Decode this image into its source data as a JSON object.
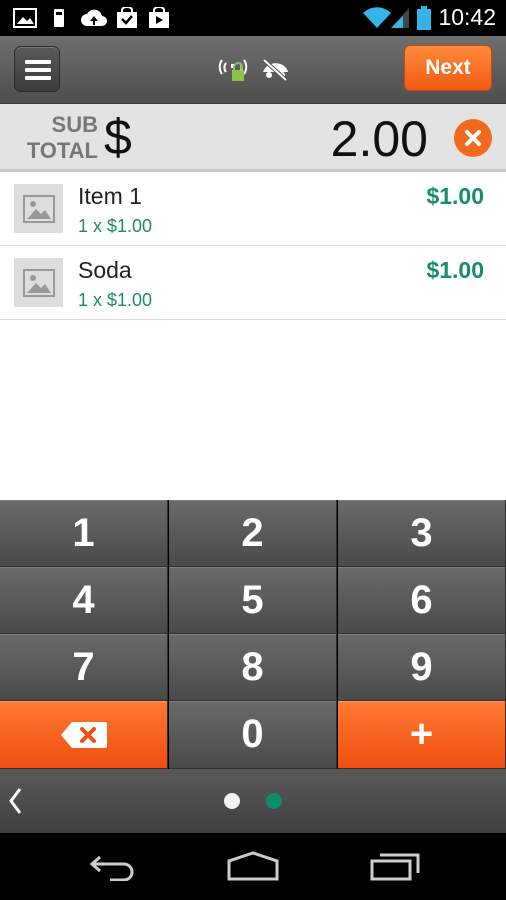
{
  "status_bar": {
    "time": "10:42",
    "icons": [
      "image-icon",
      "sim-icon",
      "cloud-upload-icon",
      "bag-check-icon",
      "play-store-icon",
      "wifi-icon",
      "signal-icon",
      "battery-icon"
    ]
  },
  "action_bar": {
    "next_label": "Next",
    "icons": [
      "menu-icon",
      "secure-wireless-icon",
      "hidden-icon"
    ]
  },
  "subtotal": {
    "label_line1": "SUB",
    "label_line2": "TOTAL",
    "currency_symbol": "$",
    "amount": "2.00"
  },
  "items": [
    {
      "name": "Item 1",
      "qty_line": "1 x $1.00",
      "price": "$1.00"
    },
    {
      "name": "Soda",
      "qty_line": "1 x $1.00",
      "price": "$1.00"
    }
  ],
  "keypad": {
    "keys": [
      "1",
      "2",
      "3",
      "4",
      "5",
      "6",
      "7",
      "8",
      "9",
      "0"
    ],
    "plus": "+"
  },
  "colors": {
    "accent_orange": "#f25a12",
    "money_green": "#1b8a6d",
    "page_dot_active": "#0f8a6a",
    "page_dot_inactive": "#f2f2f2"
  }
}
